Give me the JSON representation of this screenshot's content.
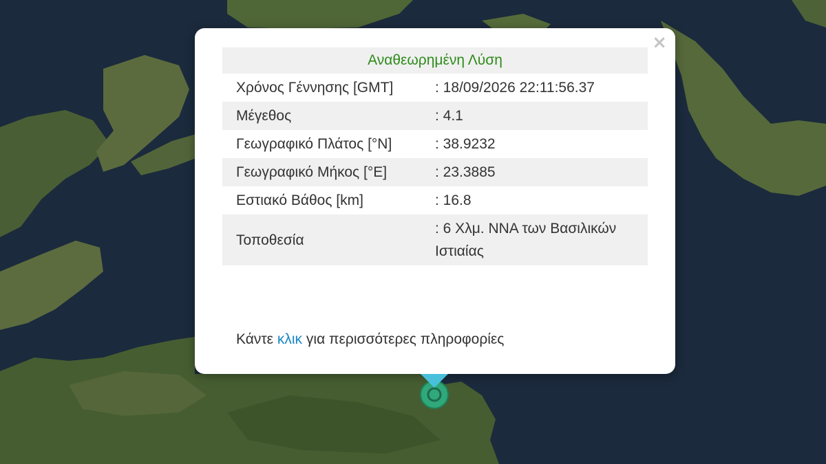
{
  "popup": {
    "close_label": "×",
    "header": "Αναθεωρημένη Λύση",
    "rows": [
      {
        "label": "Χρόνος Γέννησης [GMT]",
        "value": ": 18/09/2026 22:11:56.37"
      },
      {
        "label": "Μέγεθος",
        "value": ": 4.1"
      },
      {
        "label": "Γεωγραφικό Πλάτος [°N]",
        "value": ": 38.9232"
      },
      {
        "label": "Γεωγραφικό Μήκος [°E]",
        "value": ": 23.3885"
      },
      {
        "label": "Εστιακό Βάθος [km]",
        "value": ": 16.8"
      },
      {
        "label": "Τοποθεσία",
        "value": ": 6 Χλμ. ΝΝΑ των Βασιλικών Ιστιαίας"
      }
    ],
    "more_prefix": "Κάντε ",
    "more_link": "κλικ",
    "more_suffix": " για περισσότερες πληροφορίες"
  },
  "marker": {
    "name": "earthquake-epicenter",
    "color": "#2fa87a"
  },
  "colors": {
    "sea": "#1b2a3c",
    "land": "#3f5a2e",
    "land_light": "#6c7a49",
    "header_green": "#2e8b1a",
    "link_blue": "#1a86c4"
  }
}
